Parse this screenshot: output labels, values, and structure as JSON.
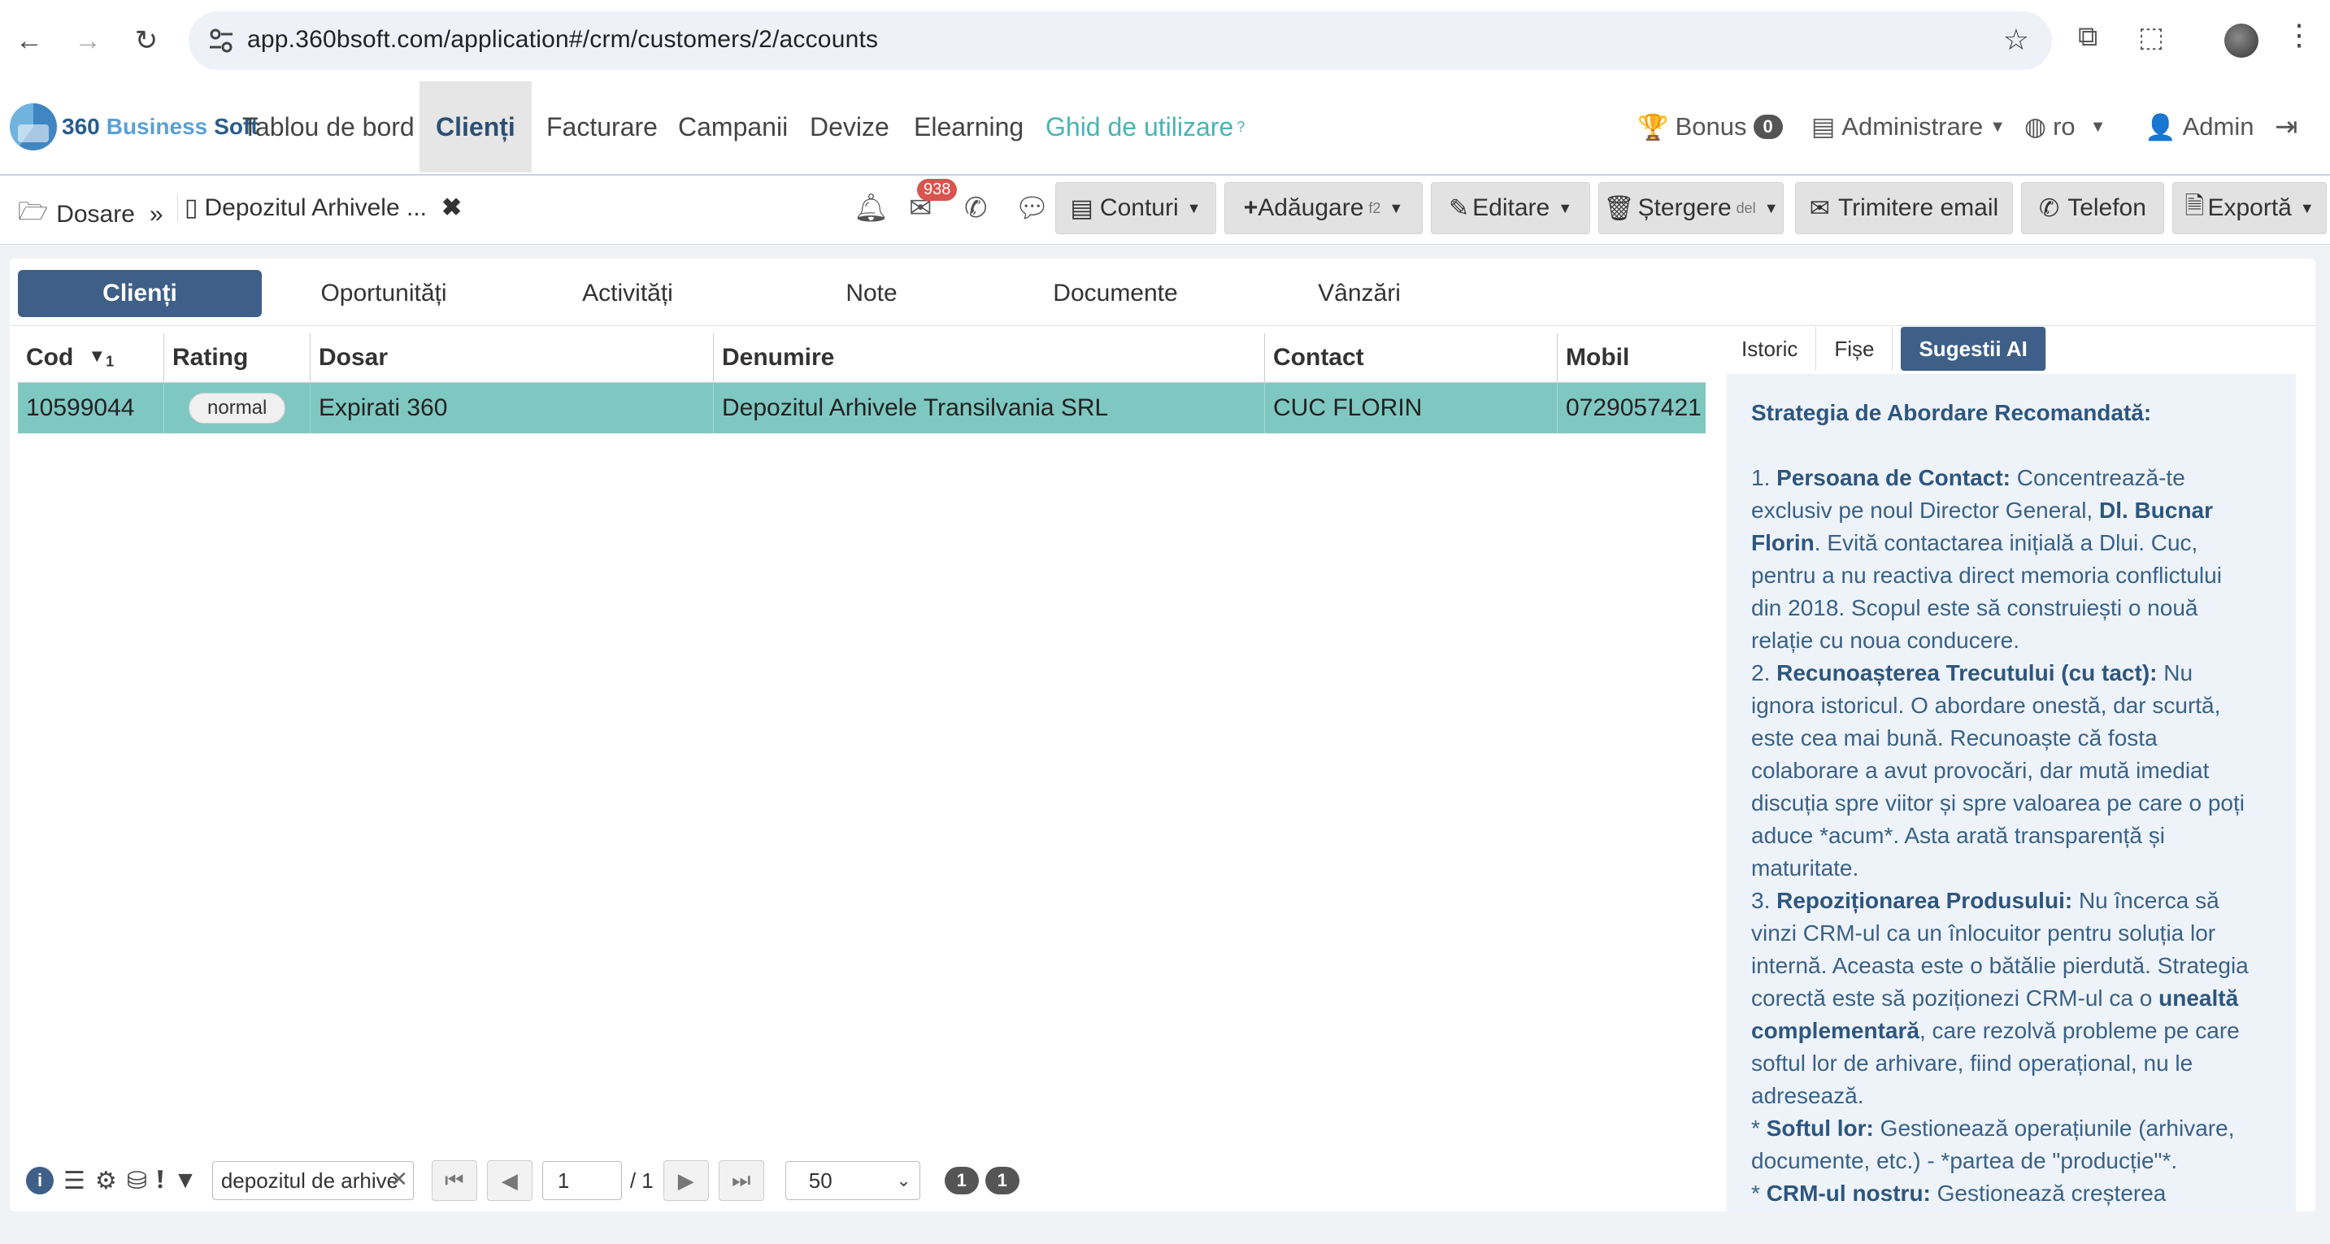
{
  "browser": {
    "url": "app.360bsoft.com/application#/crm/customers/2/accounts"
  },
  "brand": {
    "part1": "360",
    "part2": "Business",
    "part3": "Soft"
  },
  "nav": {
    "items": [
      "Tablou de bord",
      "Clienți",
      "Facturare",
      "Campanii",
      "Devize",
      "Elearning"
    ],
    "guide": "Ghid de utilizare",
    "bonus_label": "Bonus",
    "bonus_count": "0",
    "admin_menu": "Administrare",
    "language": "ro",
    "user": "Admin"
  },
  "toolbar": {
    "crumb_root": "Dosare",
    "crumb_current": "Depozitul Arhivele ...",
    "mail_count": "938",
    "buttons": {
      "conturi": "Conturi",
      "adaugare": "Adăugare",
      "adaugare_key": "f2",
      "editare": "Editare",
      "stergere": "Ștergere",
      "stergere_key": "del",
      "email": "Trimitere email",
      "telefon": "Telefon",
      "exporta": "Exportă"
    }
  },
  "tabs": [
    "Clienți",
    "Oportunități",
    "Activități",
    "Note",
    "Documente",
    "Vânzări"
  ],
  "grid": {
    "columns": [
      "Cod",
      "Rating",
      "Dosar",
      "Denumire",
      "Contact",
      "Mobil"
    ],
    "sort_index": "1",
    "rows": [
      {
        "cod": "10599044",
        "rating": "normal",
        "dosar": "Expirati 360",
        "denumire": "Depozitul Arhivele Transilvania SRL",
        "contact": "CUC FLORIN",
        "mobil": "0729057421"
      }
    ]
  },
  "footer": {
    "search_value": "depozitul de arhive",
    "page": "1",
    "total_pages": "/ 1",
    "page_size": "50",
    "count_a": "1",
    "count_b": "1"
  },
  "side": {
    "tabs": [
      "Istoric",
      "Fișe",
      "Sugestii AI"
    ],
    "title": "Strategia de Abordare Recomandată:",
    "p1_num": "1.",
    "p1_head": "Persoana de Contact:",
    "p1_a": "Concentrează-te exclusiv pe noul Director General,",
    "p1_bold": "Dl. Bucnar Florin",
    "p1_b": ". Evită contactarea inițială a Dlui. Cuc, pentru a nu reactiva direct memoria conflictului din 2018. Scopul este să construiești o nouă relație cu noua conducere.",
    "p2_num": "2.",
    "p2_head": "Recunoașterea Trecutului (cu tact):",
    "p2_a": "Nu ignora istoricul. O abordare onestă, dar scurtă, este cea mai bună. Recunoaște că fosta colaborare a avut provocări, dar mută imediat discuția spre viitor și spre valoarea pe care o poți aduce *acum*. Asta arată transparență și maturitate.",
    "p3_num": "3.",
    "p3_head": "Repoziționarea Produsului:",
    "p3_a": "Nu încerca să vinzi CRM-ul ca un înlocuitor pentru soluția lor internă. Aceasta este o bătălie pierdută. Strategia corectă este să poziționezi CRM-ul ca o",
    "p3_bold": "unealtă complementară",
    "p3_b": ", care rezolvă probleme pe care softul lor de arhivare, fiind operațional, nu le adresează.",
    "b1_head": "Softul lor:",
    "b1_a": "Gestionează operațiunile (arhivare, documente, etc.) - *partea de \"producție\"*.",
    "b2_head": "CRM-ul nostru:",
    "b2_a": "Gestionează creșterea"
  }
}
